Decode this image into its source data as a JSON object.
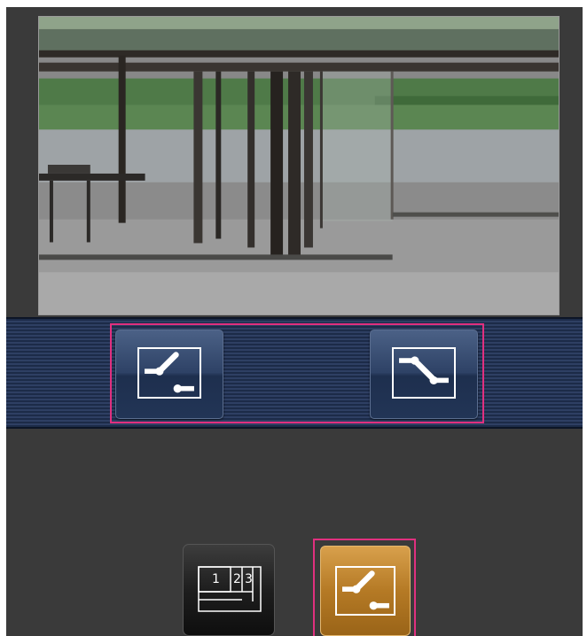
{
  "camera": {
    "image": "live-camera-image"
  },
  "controls": {
    "preset_left_icon": "tilt-up-icon",
    "preset_right_icon": "tilt-down-icon"
  },
  "bottom": {
    "multi_screen": {
      "icon": "multi-screen-icon",
      "digits": [
        "1",
        "2",
        "3"
      ]
    },
    "active": {
      "icon": "tilt-up-icon",
      "state": "selected"
    }
  },
  "colors": {
    "background": "#3a3a3a",
    "band": "#1c2b48",
    "highlight": "#e0307f",
    "active_button": "#b57a25"
  }
}
